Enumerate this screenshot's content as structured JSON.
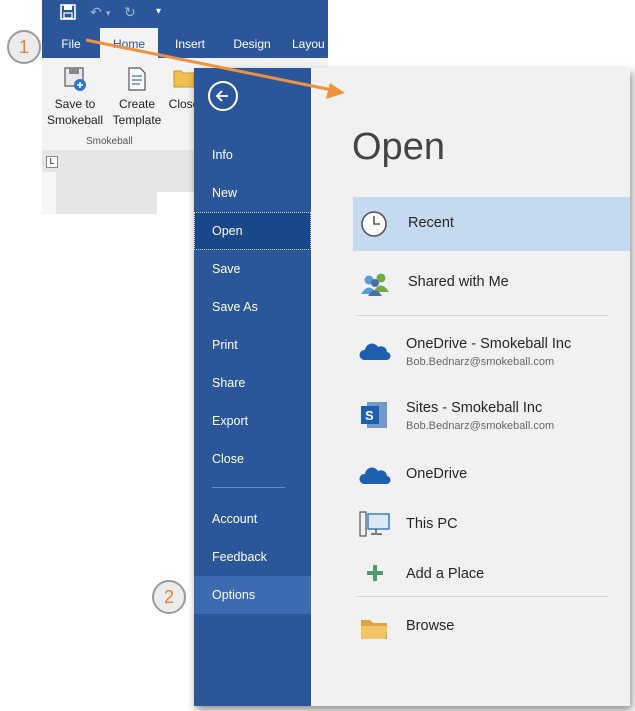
{
  "ribbon": {
    "tabs": [
      "File",
      "Home",
      "Insert",
      "Design",
      "Layou"
    ],
    "buttons": [
      {
        "label_line1": "Save to",
        "label_line2": "Smokeball"
      },
      {
        "label_line1": "Create",
        "label_line2": "Template"
      },
      {
        "label_line1": "Close",
        "label_line2": ""
      }
    ],
    "group_label": "Smokeball"
  },
  "nav": {
    "items": [
      "Info",
      "New",
      "Open",
      "Save",
      "Save As",
      "Print",
      "Share",
      "Export",
      "Close",
      "Account",
      "Feedback",
      "Options"
    ],
    "active": "Open",
    "hovered": "Options"
  },
  "open": {
    "title": "Open",
    "places": [
      {
        "name": "Recent",
        "icon": "clock-icon"
      },
      {
        "name": "Shared with Me",
        "icon": "people-icon"
      },
      {
        "name": "OneDrive - Smokeball Inc",
        "sub": "Bob.Bednarz@smokeball.com",
        "icon": "onedrive-icon"
      },
      {
        "name": "Sites - Smokeball Inc",
        "sub": "Bob.Bednarz@smokeball.com",
        "icon": "sharepoint-icon"
      },
      {
        "name": "OneDrive",
        "icon": "onedrive-icon"
      },
      {
        "name": "This PC",
        "icon": "pc-icon"
      },
      {
        "name": "Add a Place",
        "icon": "plus-icon"
      },
      {
        "name": "Browse",
        "icon": "folder-icon"
      }
    ]
  },
  "callouts": [
    "1",
    "2"
  ],
  "colors": {
    "accent": "#2b579a",
    "nav_active": "#19478a",
    "selected": "#c5d9f1",
    "arrow": "#f0913d"
  }
}
